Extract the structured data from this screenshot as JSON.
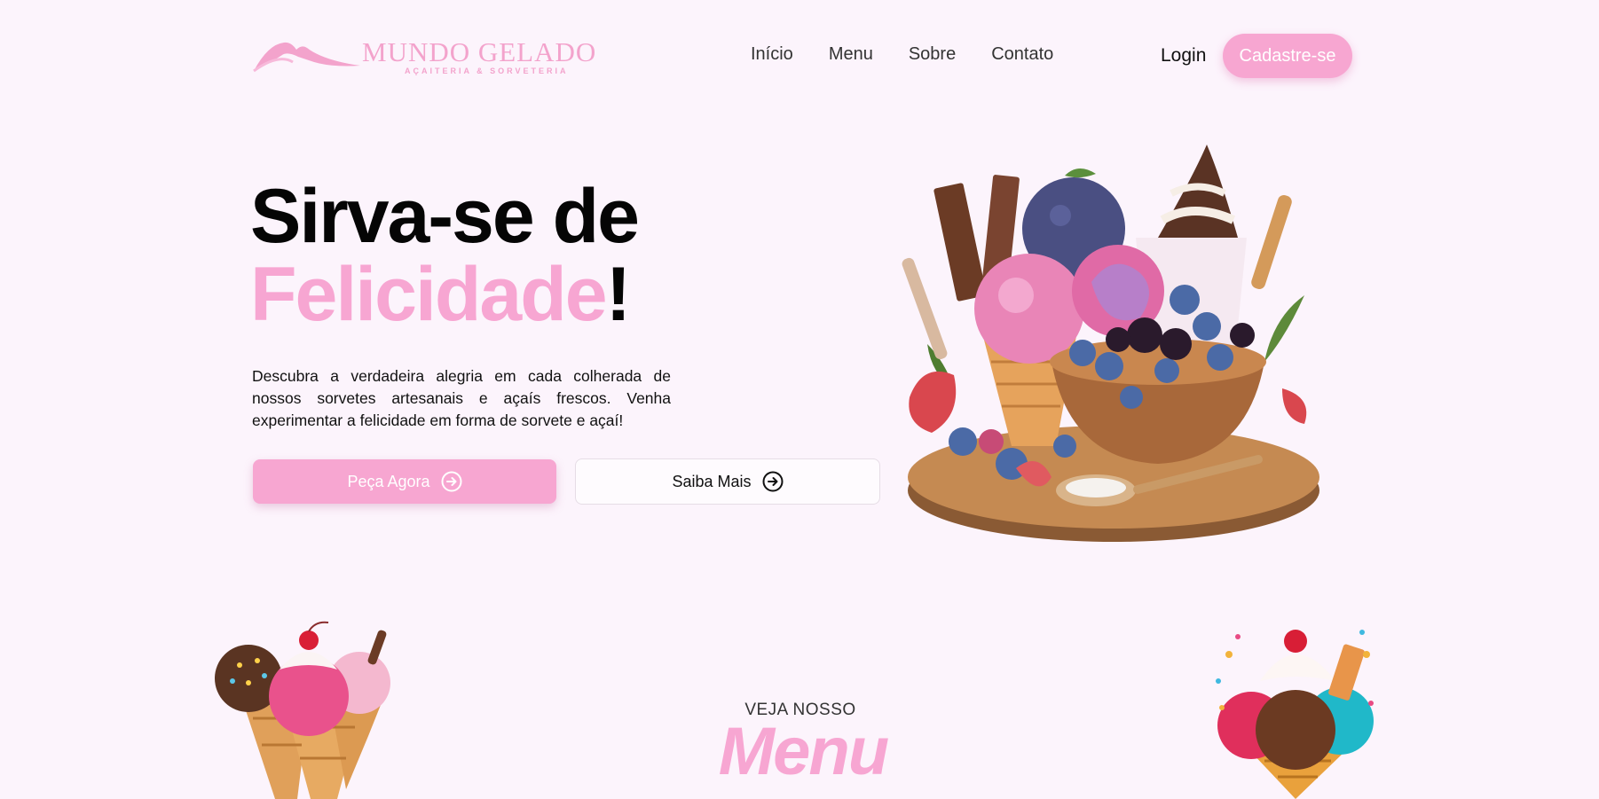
{
  "brand": {
    "name": "MUNDO GELADO",
    "tagline": "AÇAITERIA & SORVETERIA",
    "color": "#f7a6d2"
  },
  "nav": {
    "items": [
      "Início",
      "Menu",
      "Sobre",
      "Contato"
    ],
    "login_label": "Login",
    "signup_label": "Cadastre-se"
  },
  "hero": {
    "title_line1": "Sirva-se de",
    "title_highlight": "Felicidade",
    "title_end": "!",
    "description": "Descubra a verdadeira alegria em cada colherada de nossos sorvetes artesanais e açaís frescos. Venha experimentar a felicidade em forma de sorvete e açaí!",
    "primary_button": "Peça Agora",
    "secondary_button": "Saiba Mais",
    "button_icon": "circle-arrow-right-icon"
  },
  "menu_section": {
    "kicker": "VEJA NOSSO",
    "title": "Menu"
  },
  "colors": {
    "background": "#fcf4fc",
    "accent_pink": "#f7a6d1",
    "text": "#050505"
  }
}
